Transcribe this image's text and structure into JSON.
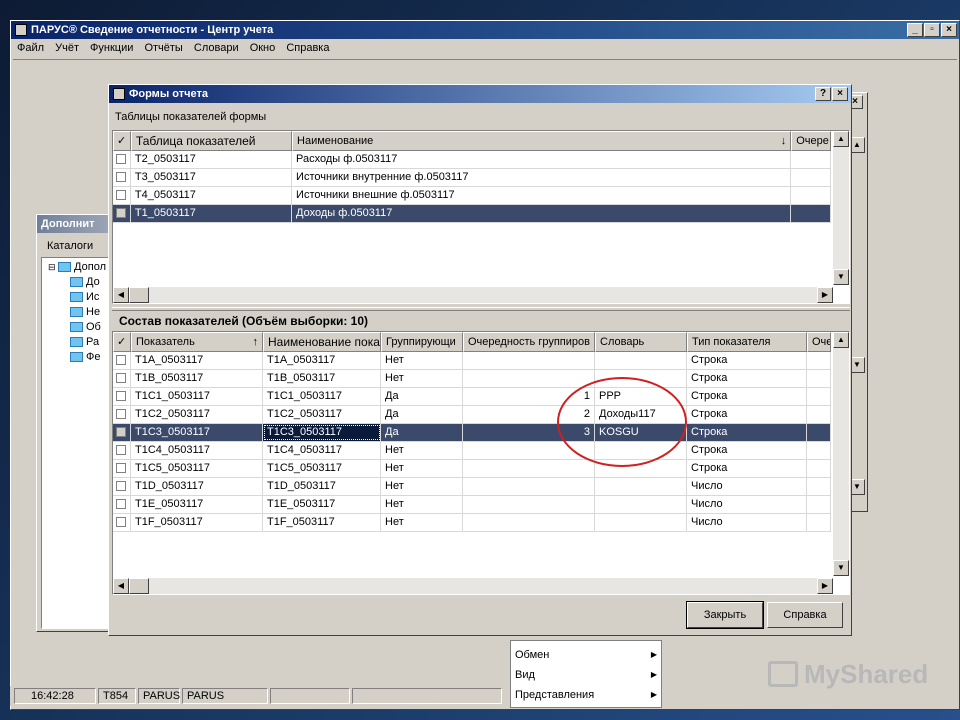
{
  "app": {
    "title": "ПАРУС® Сведение отчетности - Центр учета",
    "menu": [
      "Файл",
      "Учёт",
      "Функции",
      "Отчёты",
      "Словари",
      "Окно",
      "Справка"
    ]
  },
  "bg_window": {
    "title": "Дополнит",
    "toolbar_label": "Каталоги",
    "tree_root": "Допол",
    "tree_items": [
      "До",
      "Ис",
      "Не",
      "Об",
      "Ра",
      "Фе"
    ]
  },
  "dialog": {
    "title": "Формы отчета",
    "help_btn": "?",
    "close_btn": "×",
    "section1_label": "Таблицы показателей формы",
    "grid1": {
      "headers": [
        "✓",
        "Таблица показателей",
        "Наименование",
        "Очере"
      ],
      "rows": [
        {
          "code": "T2_0503117",
          "name": "Расходы ф.0503117"
        },
        {
          "code": "T3_0503117",
          "name": "Источники внутренние ф.0503117"
        },
        {
          "code": "T4_0503117",
          "name": "Источники внешние ф.0503117"
        },
        {
          "code": "T1_0503117",
          "name": "Доходы ф.0503117"
        }
      ]
    },
    "section2_label": "Состав показателей (Объём выборки: 10)",
    "grid2": {
      "headers": [
        "✓",
        "Показатель",
        "Наименование пока",
        "Группирующи",
        "Очередность группиров",
        "Словарь",
        "Тип показателя",
        "Оче"
      ],
      "rows": [
        {
          "code": "T1A_0503117",
          "name": "T1A_0503117",
          "group": "Нет",
          "order": "",
          "dict": "",
          "type": "Строка"
        },
        {
          "code": "T1B_0503117",
          "name": "T1B_0503117",
          "group": "Нет",
          "order": "",
          "dict": "",
          "type": "Строка"
        },
        {
          "code": "T1C1_0503117",
          "name": "T1C1_0503117",
          "group": "Да",
          "order": "1",
          "dict": "PPP",
          "type": "Строка"
        },
        {
          "code": "T1C2_0503117",
          "name": "T1C2_0503117",
          "group": "Да",
          "order": "2",
          "dict": "Доходы117",
          "type": "Строка"
        },
        {
          "code": "T1C3_0503117",
          "name": "T1C3_0503117",
          "group": "Да",
          "order": "3",
          "dict": "KOSGU",
          "type": "Строка"
        },
        {
          "code": "T1C4_0503117",
          "name": "T1C4_0503117",
          "group": "Нет",
          "order": "",
          "dict": "",
          "type": "Строка"
        },
        {
          "code": "T1C5_0503117",
          "name": "T1C5_0503117",
          "group": "Нет",
          "order": "",
          "dict": "",
          "type": "Строка"
        },
        {
          "code": "T1D_0503117",
          "name": "T1D_0503117",
          "group": "Нет",
          "order": "",
          "dict": "",
          "type": "Число"
        },
        {
          "code": "T1E_0503117",
          "name": "T1E_0503117",
          "group": "Нет",
          "order": "",
          "dict": "",
          "type": "Число"
        },
        {
          "code": "T1F_0503117",
          "name": "T1F_0503117",
          "group": "Нет",
          "order": "",
          "dict": "",
          "type": "Число"
        }
      ]
    },
    "close_button": "Закрыть",
    "help_button": "Справка"
  },
  "context_menu": {
    "items": [
      "Обмен",
      "Вид",
      "Представления"
    ]
  },
  "status_bar": {
    "cells": [
      "16:42:28",
      "T854",
      "PARUS",
      "PARUS"
    ]
  },
  "watermark": "MyShared"
}
